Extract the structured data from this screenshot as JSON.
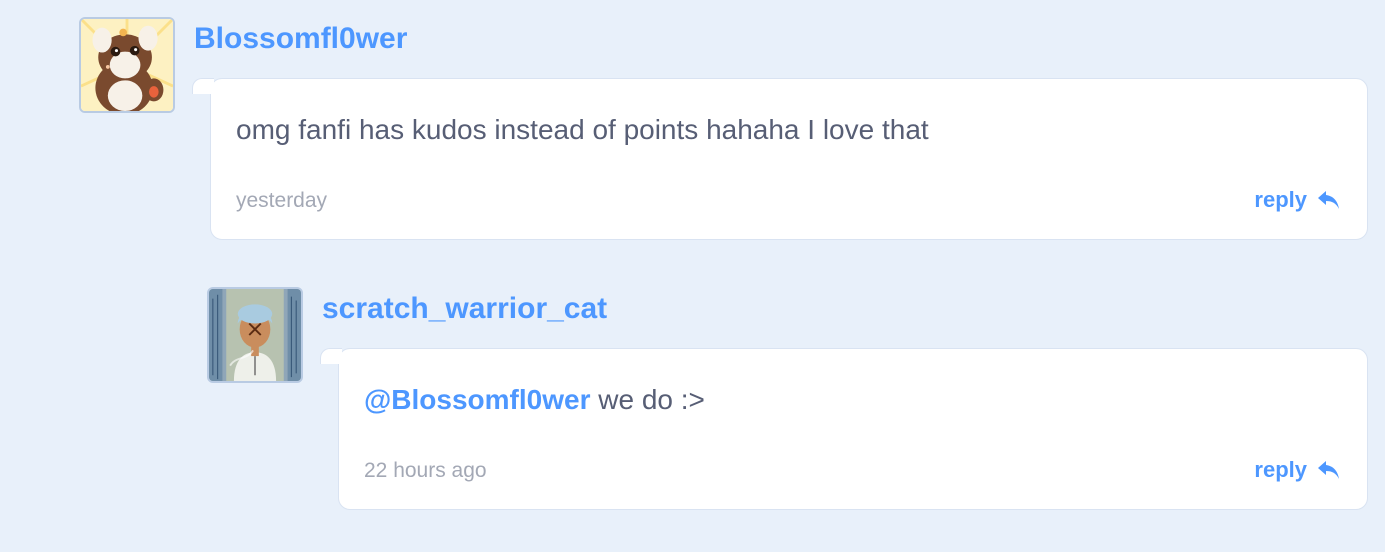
{
  "comments": [
    {
      "username": "Blossomfl0wer",
      "avatar_icon": "cat-avatar-icon",
      "text": "omg fanfi has kudos instead of points hahaha I love that",
      "timestamp": "yesterday",
      "reply_label": "reply"
    },
    {
      "username": "scratch_warrior_cat",
      "avatar_icon": "character-avatar-icon",
      "mention": "@Blossomfl0wer",
      "text": " we do :>",
      "timestamp": "22 hours ago",
      "reply_label": "reply"
    }
  ],
  "colors": {
    "background": "#e8f0fa",
    "link": "#4d97ff",
    "text": "#575e75",
    "muted": "#a3a8b5"
  }
}
